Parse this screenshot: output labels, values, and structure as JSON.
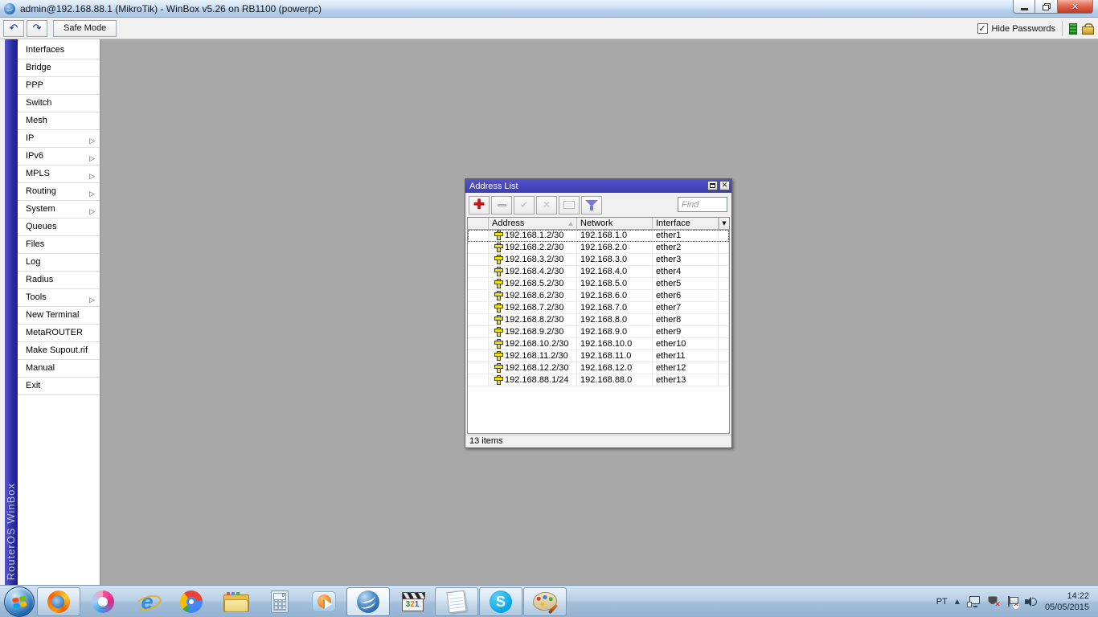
{
  "app": {
    "title": "admin@192.168.88.1 (MikroTik) - WinBox v5.26 on RB1100 (powerpc)",
    "safe_mode_label": "Safe Mode",
    "hide_passwords_label": "Hide Passwords",
    "brand_vertical": "RouterOS WinBox"
  },
  "sidebar": {
    "items": [
      {
        "label": "Interfaces",
        "submenu": false
      },
      {
        "label": "Bridge",
        "submenu": false
      },
      {
        "label": "PPP",
        "submenu": false
      },
      {
        "label": "Switch",
        "submenu": false
      },
      {
        "label": "Mesh",
        "submenu": false
      },
      {
        "label": "IP",
        "submenu": true
      },
      {
        "label": "IPv6",
        "submenu": true
      },
      {
        "label": "MPLS",
        "submenu": true
      },
      {
        "label": "Routing",
        "submenu": true
      },
      {
        "label": "System",
        "submenu": true
      },
      {
        "label": "Queues",
        "submenu": false
      },
      {
        "label": "Files",
        "submenu": false
      },
      {
        "label": "Log",
        "submenu": false
      },
      {
        "label": "Radius",
        "submenu": false
      },
      {
        "label": "Tools",
        "submenu": true
      },
      {
        "label": "New Terminal",
        "submenu": false
      },
      {
        "label": "MetaROUTER",
        "submenu": false
      },
      {
        "label": "Make Supout.rif",
        "submenu": false
      },
      {
        "label": "Manual",
        "submenu": false
      },
      {
        "label": "Exit",
        "submenu": false
      }
    ],
    "submenu_arrow": "▷"
  },
  "address_list": {
    "title": "Address List",
    "find_placeholder": "Find",
    "columns": {
      "address": "Address",
      "network": "Network",
      "interface": "Interface"
    },
    "rows": [
      {
        "address": "192.168.1.2/30",
        "network": "192.168.1.0",
        "interface": "ether1"
      },
      {
        "address": "192.168.2.2/30",
        "network": "192.168.2.0",
        "interface": "ether2"
      },
      {
        "address": "192.168.3.2/30",
        "network": "192.168.3.0",
        "interface": "ether3"
      },
      {
        "address": "192.168.4.2/30",
        "network": "192.168.4.0",
        "interface": "ether4"
      },
      {
        "address": "192.168.5.2/30",
        "network": "192.168.5.0",
        "interface": "ether5"
      },
      {
        "address": "192.168.6.2/30",
        "network": "192.168.6.0",
        "interface": "ether6"
      },
      {
        "address": "192.168.7.2/30",
        "network": "192.168.7.0",
        "interface": "ether7"
      },
      {
        "address": "192.168.8.2/30",
        "network": "192.168.8.0",
        "interface": "ether8"
      },
      {
        "address": "192.168.9.2/30",
        "network": "192.168.9.0",
        "interface": "ether9"
      },
      {
        "address": "192.168.10.2/30",
        "network": "192.168.10.0",
        "interface": "ether10"
      },
      {
        "address": "192.168.11.2/30",
        "network": "192.168.11.0",
        "interface": "ether11"
      },
      {
        "address": "192.168.12.2/30",
        "network": "192.168.12.0",
        "interface": "ether12"
      },
      {
        "address": "192.168.88.1/24",
        "network": "192.168.88.0",
        "interface": "ether13"
      }
    ],
    "status": "13 items"
  },
  "taskbar": {
    "icons": [
      "start",
      "firefox",
      "spark-browser",
      "internet-explorer",
      "chrome",
      "windows-explorer",
      "calculator",
      "windows-media-player",
      "winbox",
      "media-player-classic",
      "notepad",
      "skype",
      "paint"
    ],
    "tray": {
      "language": "PT",
      "time": "14:22",
      "date": "05/05/2015"
    }
  },
  "mpc_digits": {
    "d3": "3",
    "d2": "2",
    "d1": "1"
  },
  "colors": {
    "al_titlebar_blue": "#4646c0",
    "desktop_gray": "#a8a8a8",
    "sidebar_strip_blue": "#2a2aa4",
    "taskbar_blue": "#b9d0e7",
    "add_button_red": "#cc1111",
    "funnel_blue": "#7878d8",
    "row_icon_yellow": "#f2e400"
  }
}
